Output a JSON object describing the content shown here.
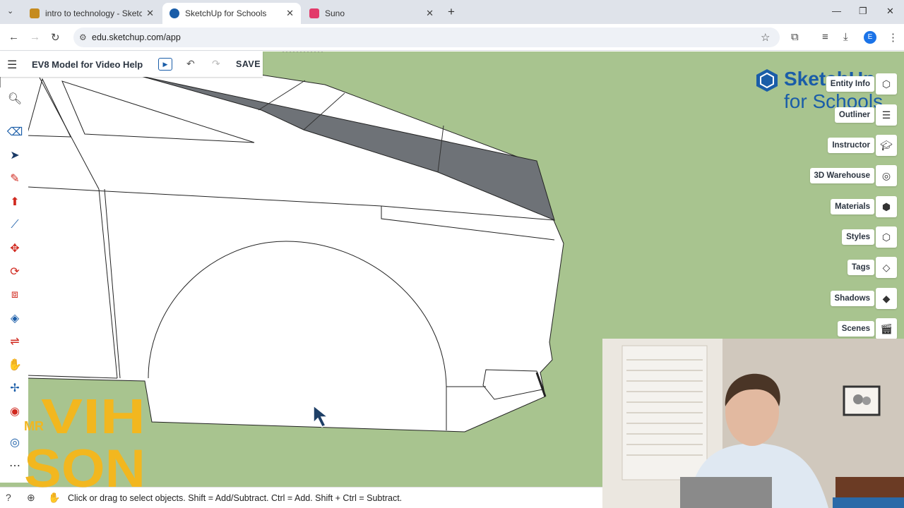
{
  "browser": {
    "tabs": [
      {
        "title": "intro to technology - SketchUp",
        "active": false
      },
      {
        "title": "SketchUp for Schools",
        "active": true
      },
      {
        "title": "Suno",
        "active": false
      }
    ],
    "url": "edu.sketchup.com/app",
    "profile_initial": "E"
  },
  "app": {
    "model_title": "EV8 Model for Video Help",
    "save_label": "SAVE",
    "logo_line1": "SketchUp",
    "logo_line2": "for Schools"
  },
  "panels": [
    "Entity Info",
    "Outliner",
    "Instructor",
    "3D Warehouse",
    "Materials",
    "Styles",
    "Tags",
    "Shadows",
    "Scenes"
  ],
  "status": {
    "text": "Click or drag to select objects. Shift = Add/Subtract. Ctrl = Add. Shift + Ctrl = Subtract."
  },
  "overlay": {
    "brand_line1": "MR",
    "brand_line2": "VIH",
    "brand_line3": "SON"
  },
  "colors": {
    "viewport_bg": "#a8c48f",
    "brand_yellow": "#f2b71f",
    "accent_blue": "#1a5da8",
    "glass_gray": "#6e7277"
  }
}
